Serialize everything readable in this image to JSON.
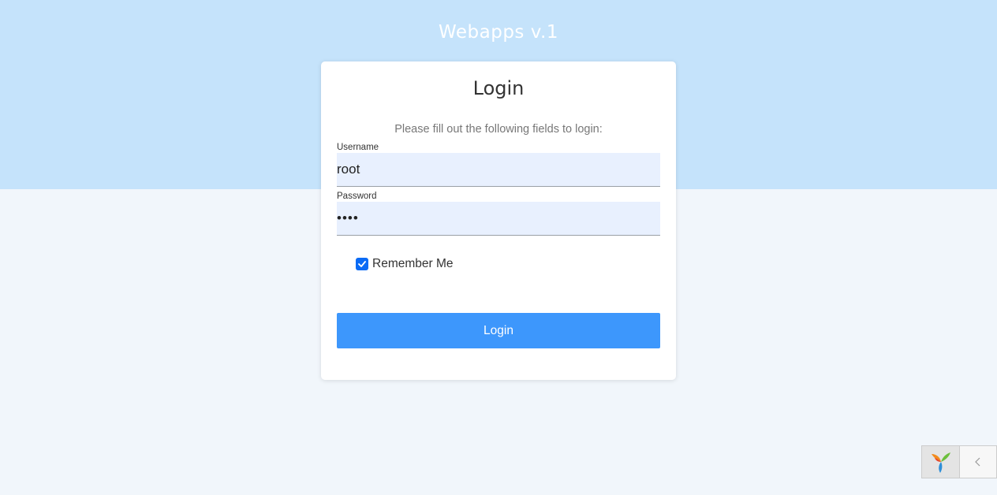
{
  "app": {
    "title": "Webapps v.1"
  },
  "login": {
    "title": "Login",
    "subtitle": "Please fill out the following fields to login:",
    "username": {
      "label": "Username",
      "value": "root"
    },
    "password": {
      "label": "Password",
      "value": "••••"
    },
    "remember_me": {
      "label": "Remember Me",
      "checked": true
    },
    "submit_label": "Login"
  },
  "debug_toolbar": {
    "logo_icon": "yii-logo-icon",
    "toggle_icon": "chevron-left-icon"
  },
  "colors": {
    "header_band": "#c5e3fb",
    "page_background": "#f1f6fb",
    "input_background": "#e8f0fe",
    "button": "#3d97fc",
    "checkbox": "#0b6bf5"
  }
}
